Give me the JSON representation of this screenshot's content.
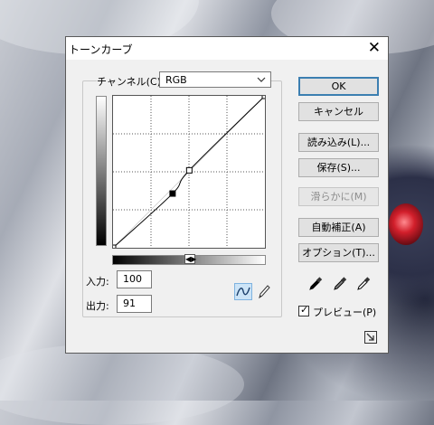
{
  "dialog": {
    "title": "トーンカーブ",
    "close_glyph": "✕"
  },
  "channel": {
    "label": "チャンネル(C):",
    "value": "RGB"
  },
  "input": {
    "label": "入力:",
    "value": "100"
  },
  "output": {
    "label": "出力:",
    "value": "91"
  },
  "buttons": {
    "ok": "OK",
    "cancel": "キャンセル",
    "load": "読み込み(L)...",
    "save": "保存(S)...",
    "smooth": "滑らかに(M)",
    "auto": "自動補正(A)",
    "options": "オプション(T)..."
  },
  "preview": {
    "label": "プレビュー(P)",
    "checked": true,
    "check_glyph": "✓"
  },
  "ramp_handle_glyph": "◀▶",
  "curve_points": [
    {
      "in": 0,
      "out": 0
    },
    {
      "in": 100,
      "out": 91
    },
    {
      "in": 128,
      "out": 130
    },
    {
      "in": 255,
      "out": 255
    }
  ],
  "selected_point_index": 1,
  "icons": [
    "close-icon",
    "chevron-down-icon",
    "curve-tool-icon",
    "pencil-tool-icon",
    "black-eyedropper-icon",
    "gray-eyedropper-icon",
    "white-eyedropper-icon",
    "resize-icon"
  ],
  "colors": {
    "dialog_bg": "#f0f0f0",
    "default_button_border": "#3c7fb1",
    "selected_tool_bg": "#cce4f7"
  }
}
